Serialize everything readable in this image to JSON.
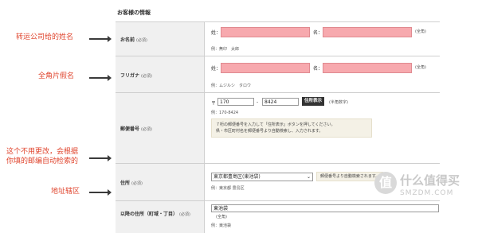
{
  "section_title": "お客様の情報",
  "rows": {
    "name": {
      "label": "お名前",
      "required": "(必須)",
      "last_label": "姓：",
      "first_label": "名：",
      "note": "(全角)",
      "example": "例：無印　太郎"
    },
    "kana": {
      "label": "フリガナ",
      "required": "(必須)",
      "last_label": "姓：",
      "first_label": "名：",
      "note": "(全角)",
      "example": "例：ムジルシ　タロウ"
    },
    "postal": {
      "label": "郵便番号",
      "required": "(必須)",
      "prefix": "〒",
      "part1": "170",
      "dash": "-",
      "part2": "8424",
      "button": "住所表示",
      "hint": "(半角数字)",
      "example": "例：170-8424",
      "note_line1": "７桁の郵便番号を入力して「住所表示」ボタンを押してください。",
      "note_line2": "県・市区町村名を郵便番号より自動検索し、入力されます。"
    },
    "address": {
      "label": "住所",
      "required": "(必須)",
      "selected": "東京都豊島区(東池袋)",
      "badge": "郵便番号より自動検索されます。",
      "example": "例：東京都 豊島区"
    },
    "street": {
      "label": "以降の住所（町域・丁目）",
      "required": "(必須)",
      "value": "東池袋",
      "note": "(全角)",
      "example": "例：東池袋"
    }
  },
  "annotations": {
    "a1": "转运公司给的姓名",
    "a2": "全角片假名",
    "a3_line1": "这个不用更改，会根据",
    "a3_line2": "你填的邮编自动检索的",
    "a4": "地址辖区"
  },
  "watermark": {
    "icon": "值",
    "title": "什么值得买",
    "sub": "SMZDM.COM"
  },
  "colors": {
    "annotation": "#e0462f",
    "input_pink": "#f7a9ae"
  }
}
